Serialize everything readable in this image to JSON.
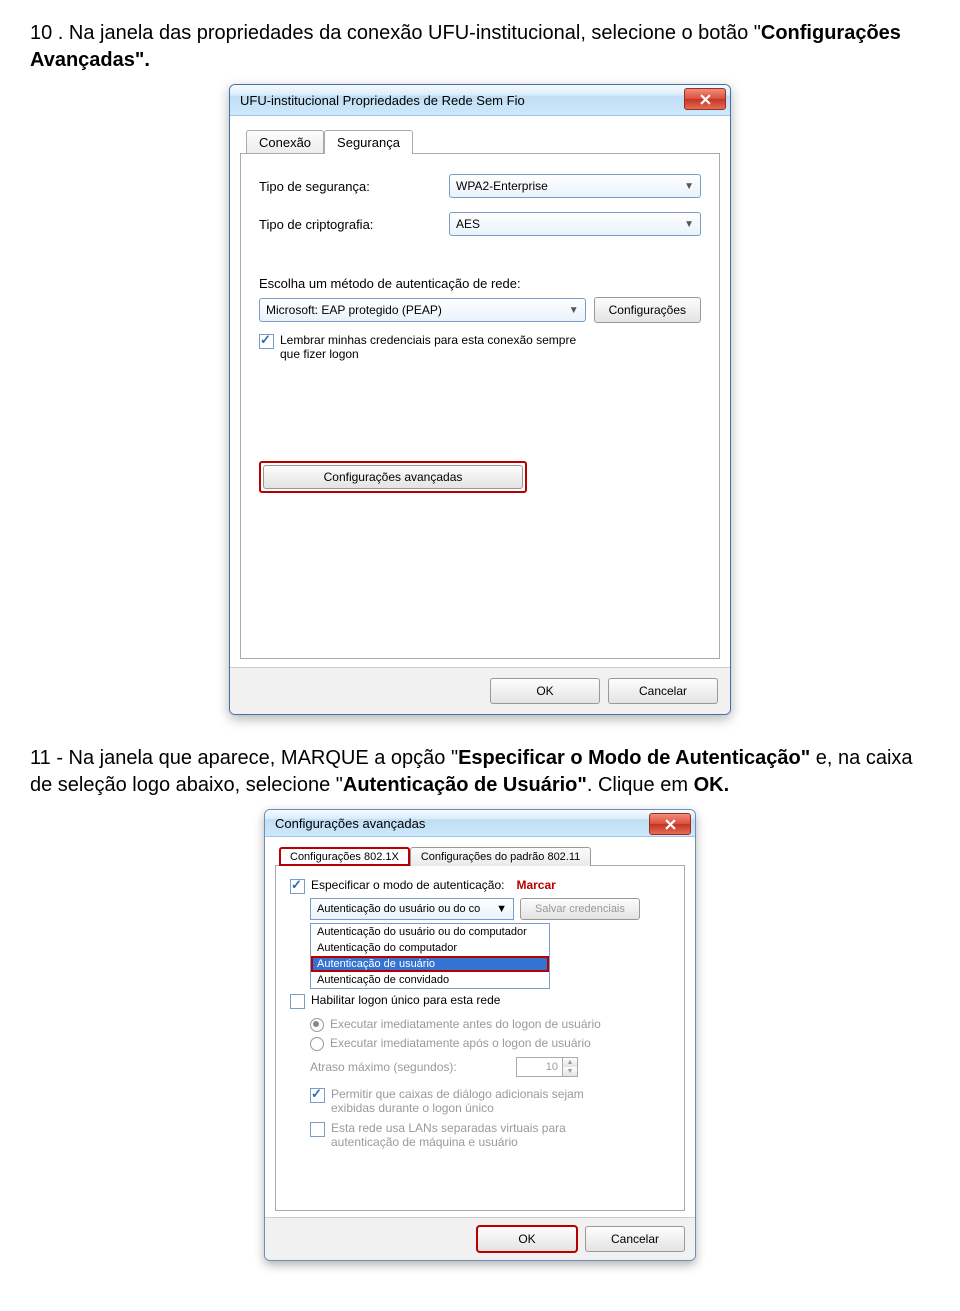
{
  "instruction10_pre": "10 . Na janela das propriedades da conexão UFU-institucional, selecione o botão \"",
  "instruction10_bold": "Configurações Avançadas\".",
  "dialog1": {
    "title": "UFU-institucional Propriedades de Rede Sem Fio",
    "tab_connection": "Conexão",
    "tab_security": "Segurança",
    "label_sec_type": "Tipo de segurança:",
    "val_sec_type": "WPA2-Enterprise",
    "label_crypt": "Tipo de criptografia:",
    "val_crypt": "AES",
    "label_auth_method": "Escolha um método de autenticação de rede:",
    "val_auth_method": "Microsoft: EAP protegido (PEAP)",
    "btn_config": "Configurações",
    "check_remember": "Lembrar minhas credenciais para esta conexão sempre que fizer logon",
    "btn_adv": "Configurações avançadas",
    "btn_ok": "OK",
    "btn_cancel": "Cancelar"
  },
  "instruction11_pre": "11 - Na janela que aparece, MARQUE a opção \"",
  "instruction11_b1": "Especificar o Modo de Autenticação\"",
  "instruction11_mid": " e, na caixa de seleção logo abaixo, selecione \"",
  "instruction11_b2": "Autenticação de Usuário\"",
  "instruction11_post": ". Clique em ",
  "instruction11_b3": "OK.",
  "dialog2": {
    "title": "Configurações avançadas",
    "tab1": "Configurações 802.1X",
    "tab2": "Configurações do padrão 802.11",
    "check_specify": "Especificar o modo de autenticação:",
    "marcar": "Marcar",
    "combo_val": "Autenticação do usuário ou do co",
    "btn_save": "Salvar credenciais",
    "opt1": "Autenticação do usuário ou do computador",
    "opt2": "Autenticação do computador",
    "opt3": "Autenticação de usuário",
    "opt4": "Autenticação de convidado",
    "check_sso": "Habilitar logon único para esta rede",
    "radio1": "Executar imediatamente antes do logon de usuário",
    "radio2": "Executar imediatamente após o logon de usuário",
    "label_delay": "Atraso máximo (segundos):",
    "delay_val": "10",
    "check_dialogs": "Permitir que caixas de diálogo adicionais sejam exibidas durante o logon único",
    "check_vlans": "Esta rede usa LANs separadas virtuais para autenticação de máquina e usuário",
    "btn_ok": "OK",
    "btn_cancel": "Cancelar"
  }
}
